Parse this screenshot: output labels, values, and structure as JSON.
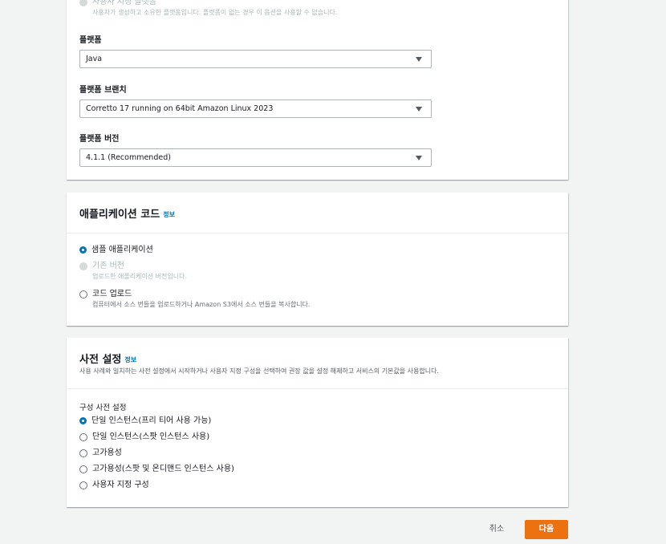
{
  "platform_panel": {
    "custom_platform": {
      "label": "사용자 지정 플랫폼",
      "description": "사용자가 생성하고 소유한 플랫폼입니다. 플랫폼이 없는 경우 이 옵션을 사용할 수 없습니다."
    },
    "platform": {
      "label": "플랫폼",
      "value": "Java"
    },
    "branch": {
      "label": "플랫폼 브랜치",
      "value": "Corretto 17 running on 64bit Amazon Linux 2023"
    },
    "version": {
      "label": "플랫폼 버전",
      "value": "4.1.1 (Recommended)"
    }
  },
  "code_panel": {
    "title": "애플리케이션 코드",
    "info": "정보",
    "options": [
      {
        "label": "샘플 애플리케이션",
        "description": "",
        "state": "checked"
      },
      {
        "label": "기존 버전",
        "description": "업로드한 애플리케이션 버전입니다.",
        "state": "disabled"
      },
      {
        "label": "코드 업로드",
        "description": "컴퓨터에서 소스 번들을 업로드하거나 Amazon S3에서 소스 번들을 복사합니다.",
        "state": "unchecked"
      }
    ]
  },
  "preset_panel": {
    "title": "사전 설정",
    "info": "정보",
    "description": "사용 사례와 일치하는 사전 설정에서 시작하거나 사용자 지정 구성을 선택하여 권장 값을 설정 해제하고 서비스의 기본값을 사용합니다.",
    "group_label": "구성 사전 설정",
    "options": [
      {
        "label": "단일 인스턴스(프리 티어 사용 가능)",
        "state": "checked"
      },
      {
        "label": "단일 인스턴스(스팟 인스턴스 사용)",
        "state": "unchecked"
      },
      {
        "label": "고가용성",
        "state": "unchecked"
      },
      {
        "label": "고가용성(스팟 및 온디맨드 인스턴스 사용)",
        "state": "unchecked"
      },
      {
        "label": "사용자 지정 구성",
        "state": "unchecked"
      }
    ]
  },
  "footer": {
    "cancel_label": "취소",
    "next_label": "다음"
  },
  "colors": {
    "accent": "#0073bb",
    "primary_button": "#ec7211",
    "background": "#f2f3f3"
  }
}
